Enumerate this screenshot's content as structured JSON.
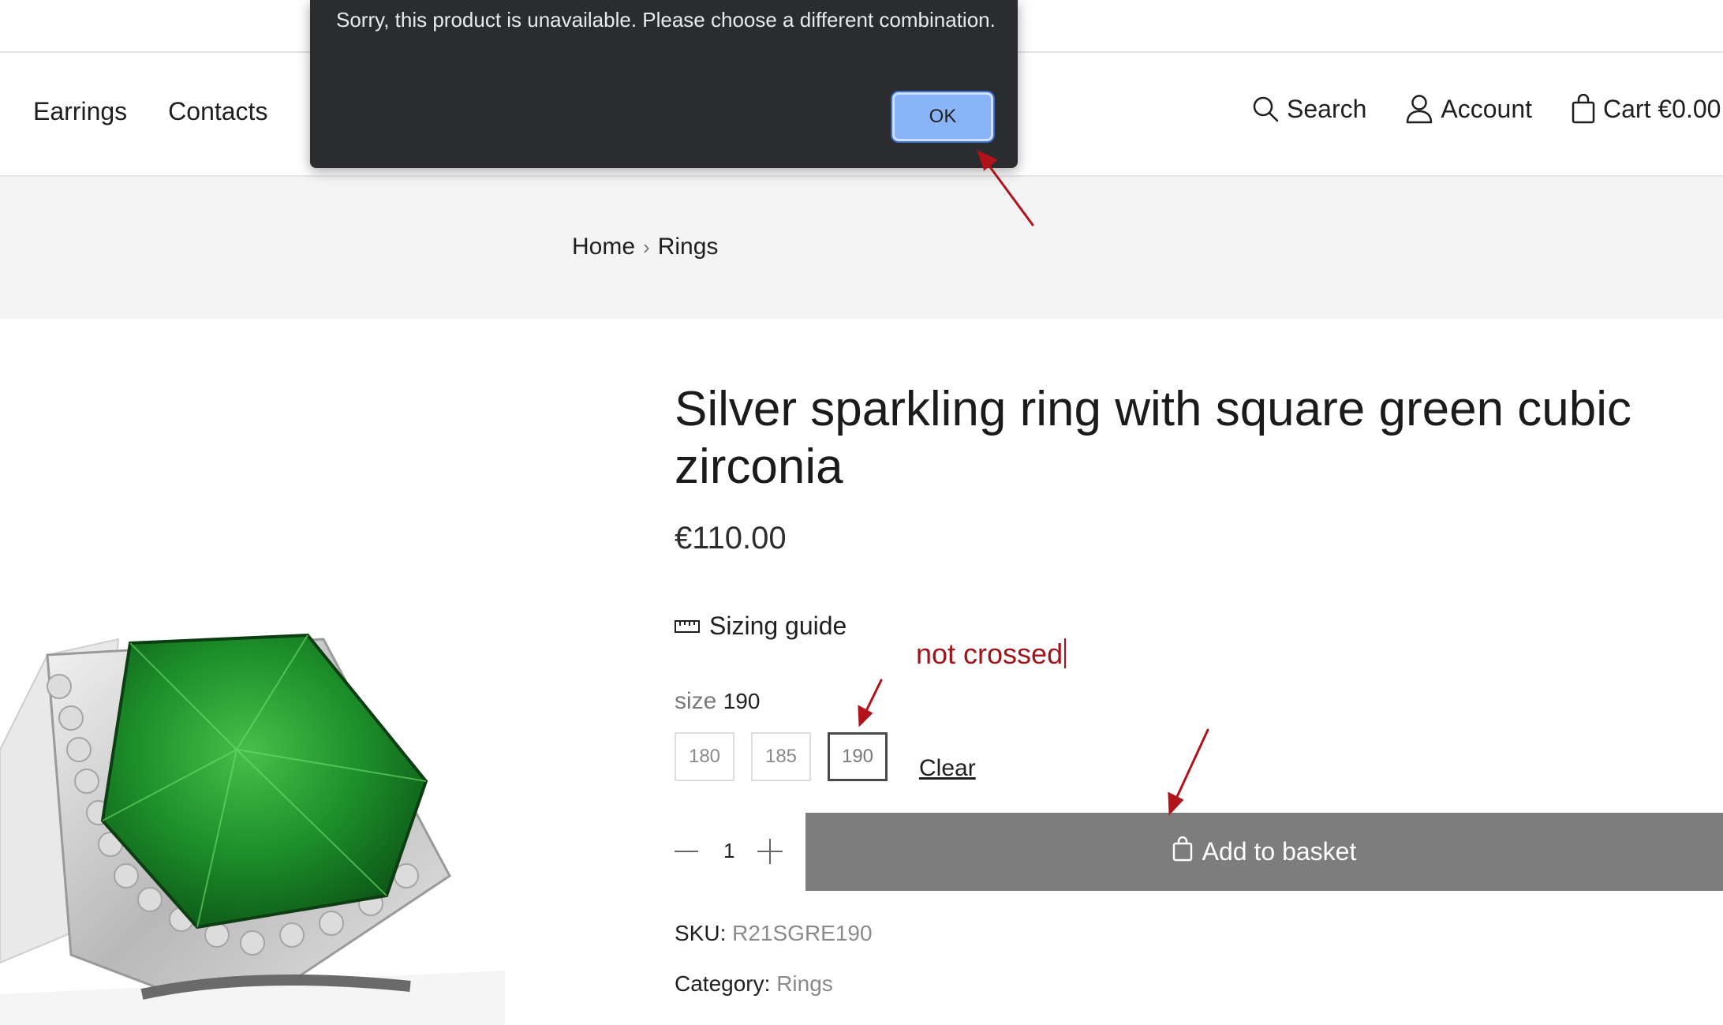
{
  "header": {
    "nav_left": [
      "Earrings",
      "Contacts"
    ],
    "search_label": "Search",
    "account_label": "Account",
    "cart_label": "Cart €0.00"
  },
  "icons": {
    "search": "search-icon",
    "account": "user-icon",
    "cart": "shopping-bag-icon",
    "ruler": "ruler-icon",
    "basket": "shopping-bag-icon",
    "breadcrumb_separator": "chevron-right-icon"
  },
  "breadcrumb": {
    "items": [
      "Home",
      "Rings"
    ],
    "separator": "›"
  },
  "product": {
    "title": "Silver sparkling ring with square green cubic zirconia",
    "price": "€110.00",
    "sizing_guide_label": "Sizing guide",
    "size_label": "size",
    "selected_size": "190",
    "size_options": [
      "180",
      "185",
      "190"
    ],
    "clear_label": "Clear",
    "quantity": "1",
    "add_to_basket_label": "Add to basket",
    "sku_label": "SKU:",
    "sku_value": "R21SGRE190",
    "category_label": "Category:",
    "category_value": "Rings"
  },
  "dialog": {
    "message": "Sorry, this product is unavailable. Please choose a different combination.",
    "ok_label": "OK"
  },
  "annotation": {
    "text": "not crossed"
  },
  "colors": {
    "accent_ok_button": "#8ab4f8",
    "dialog_background": "#2b2c2f",
    "basket_button": "#7d7d7d",
    "annotation_red": "#a0141b",
    "breadcrumb_band": "#f4f4f4"
  }
}
